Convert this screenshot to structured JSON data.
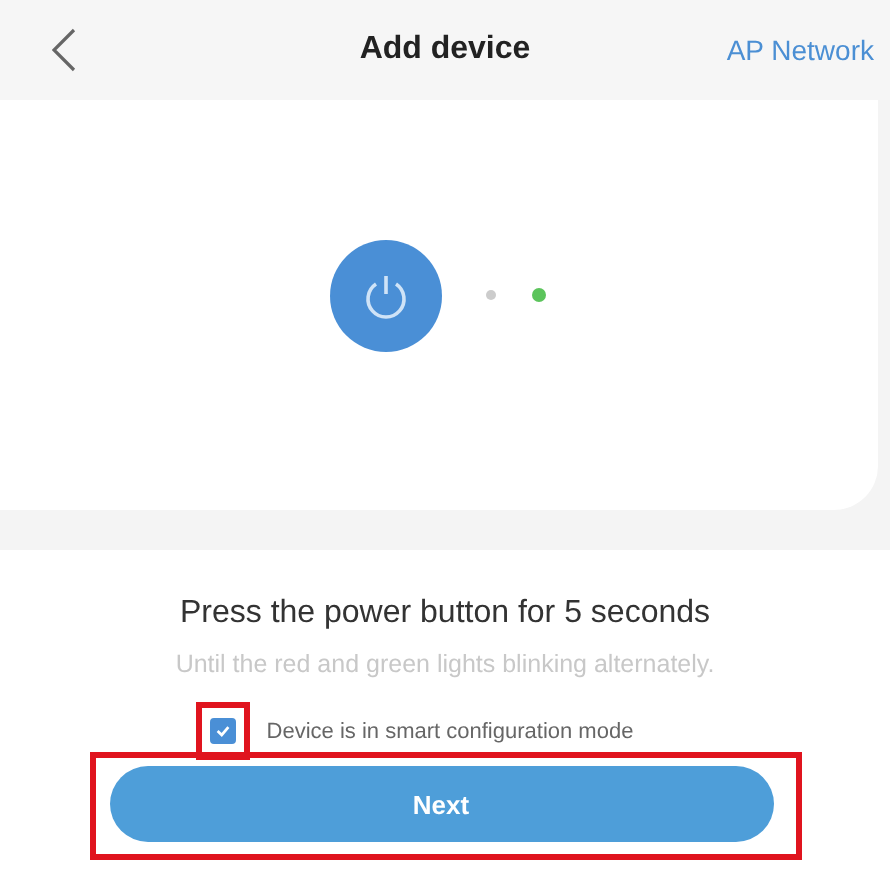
{
  "header": {
    "title": "Add device",
    "action": "AP Network"
  },
  "device": {
    "lights": [
      {
        "on": false
      },
      {
        "on": true
      }
    ]
  },
  "instruction": {
    "title": "Press the power button for 5 seconds",
    "hint": "Until the red and green lights blinking alternately."
  },
  "confirm": {
    "label": "Device is in smart configuration mode",
    "checked": true,
    "highlighted": true
  },
  "next_button": {
    "label": "Next",
    "highlighted": true
  }
}
